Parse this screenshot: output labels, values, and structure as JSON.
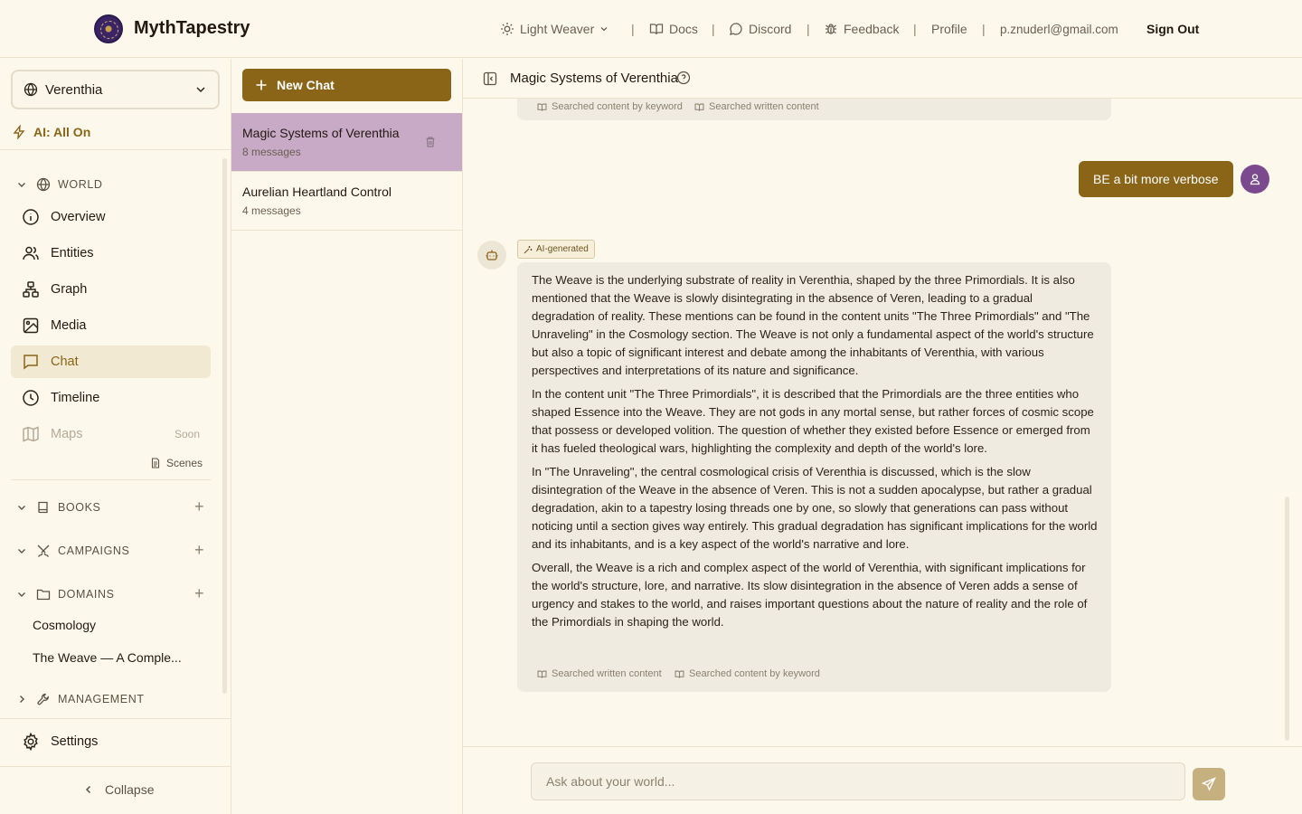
{
  "header": {
    "brand": "MythTapestry",
    "theme_label": "Light Weaver",
    "docs": "Docs",
    "discord": "Discord",
    "feedback": "Feedback",
    "profile": "Profile",
    "email": "p.znuderl@gmail.com",
    "sign_out": "Sign Out",
    "separator": "|"
  },
  "sidebar": {
    "world": "Verenthia",
    "ai_status": "AI: All On",
    "world_section": "WORLD",
    "nav": {
      "overview": "Overview",
      "entities": "Entities",
      "graph": "Graph",
      "media": "Media",
      "chat": "Chat",
      "timeline": "Timeline",
      "maps": "Maps",
      "maps_badge": "Soon"
    },
    "scenes": "Scenes",
    "books": "BOOKS",
    "campaigns": "CAMPAIGNS",
    "domains": "DOMAINS",
    "domain_items": [
      "Cosmology",
      "The Weave — A Comple..."
    ],
    "management": "MANAGEMENT",
    "settings": "Settings",
    "collapse": "Collapse"
  },
  "chat_list": {
    "new_chat": "New Chat",
    "items": [
      {
        "title": "Magic Systems of Verenthia",
        "meta": "8 messages"
      },
      {
        "title": "Aurelian Heartland Control",
        "meta": "4 messages"
      }
    ]
  },
  "conversation": {
    "title": "Magic Systems of Verenthia",
    "prev_sources": [
      "Searched content by keyword",
      "Searched written content"
    ],
    "user_message": "BE a bit more verbose",
    "ai_badge": "AI-generated",
    "ai_paragraphs": [
      "The Weave is the underlying substrate of reality in Verenthia, shaped by the three Primordials. It is also mentioned that the Weave is slowly disintegrating in the absence of Veren, leading to a gradual degradation of reality. These mentions can be found in the content units \"The Three Primordials\" and \"The Unraveling\" in the Cosmology section. The Weave is not only a fundamental aspect of the world's structure but also a topic of significant interest and debate among the inhabitants of Verenthia, with various perspectives and interpretations of its nature and significance.",
      "In the content unit \"The Three Primordials\", it is described that the Primordials are the three entities who shaped Essence into the Weave. They are not gods in any mortal sense, but rather forces of cosmic scope that possess or developed volition. The question of whether they existed before Essence or emerged from it has fueled theological wars, highlighting the complexity and depth of the world's lore.",
      "In \"The Unraveling\", the central cosmological crisis of Verenthia is discussed, which is the slow disintegration of the Weave in the absence of Veren. This is not a sudden apocalypse, but rather a gradual degradation, akin to a tapestry losing threads one by one, so slowly that generations can pass without noticing until a section gives way entirely. This gradual degradation has significant implications for the world and its inhabitants, and is a key aspect of the world's narrative and lore.",
      "Overall, the Weave is a rich and complex aspect of the world of Verenthia, with significant implications for the world's structure, lore, and narrative. Its slow disintegration in the absence of Veren adds a sense of urgency and stakes to the world, and raises important questions about the nature of reality and the role of the Primordials in shaping the world."
    ],
    "ai_sources": [
      "Searched written content",
      "Searched content by keyword"
    ],
    "input_placeholder": "Ask about your world..."
  },
  "colors": {
    "accent": "#8a6518",
    "active_chat": "#c8a9c6",
    "background": "#fdf8ec",
    "bubble": "#f0ebe0",
    "user_avatar": "#7b4a8e"
  }
}
